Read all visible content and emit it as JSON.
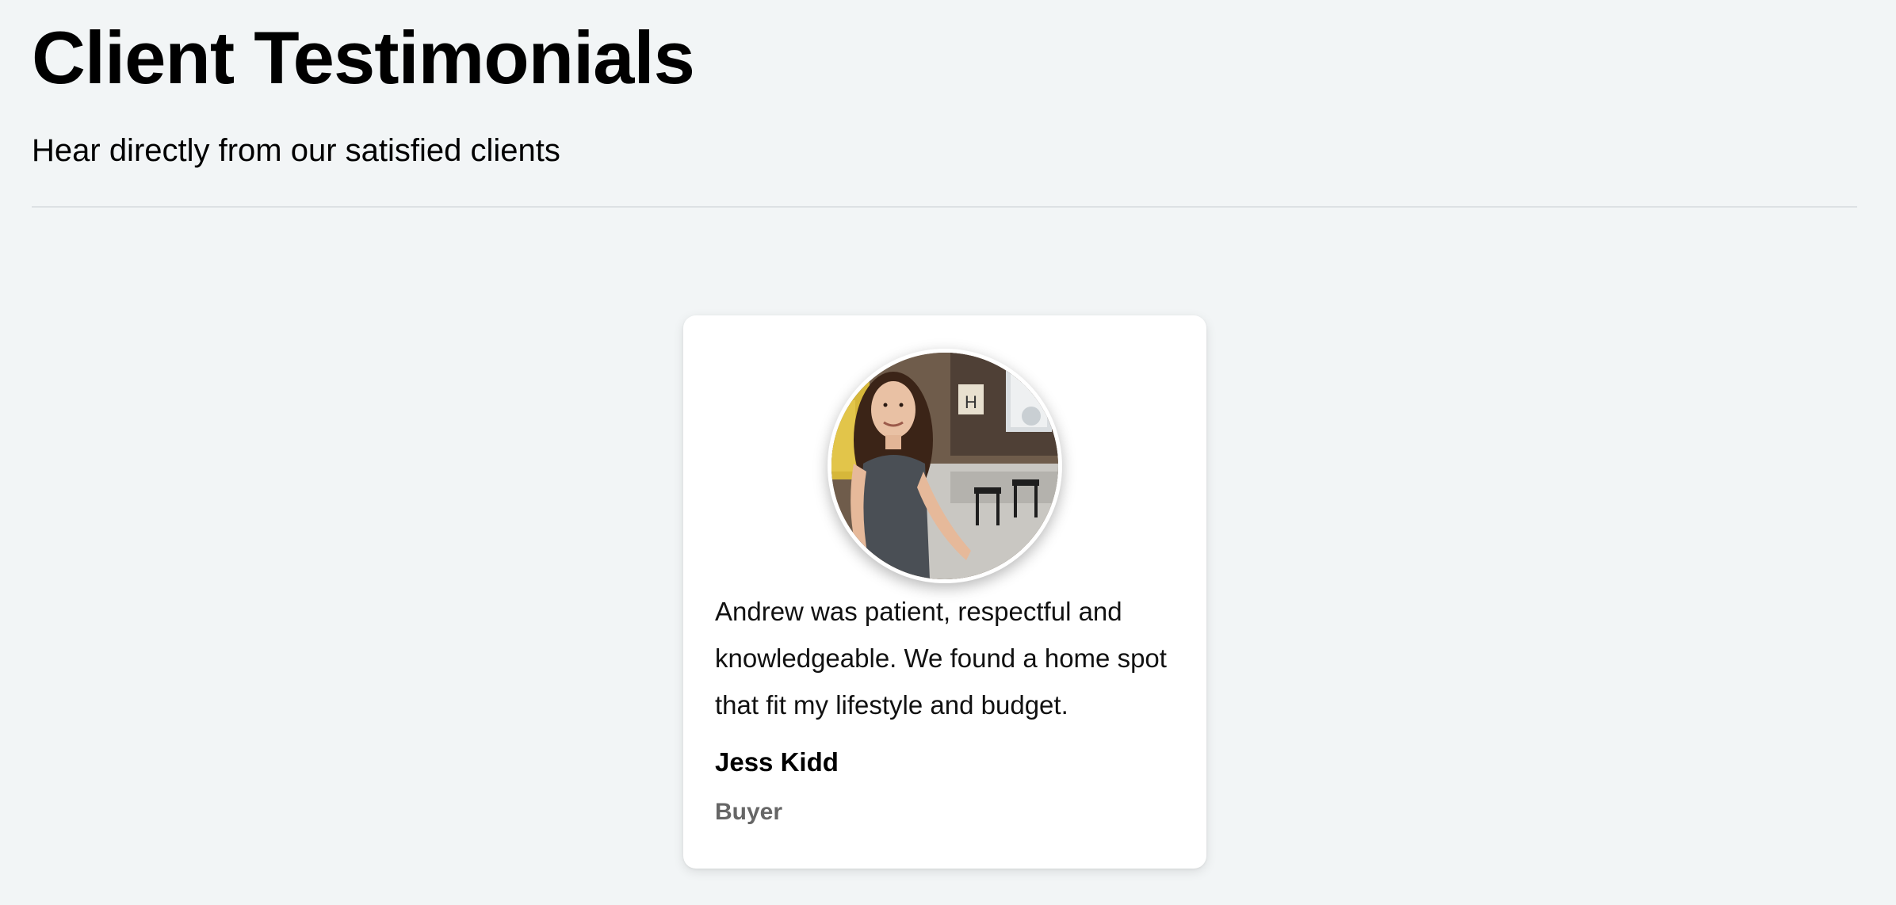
{
  "header": {
    "title": "Client Testimonials",
    "subtitle": "Hear directly from our satisfied clients"
  },
  "testimonials": [
    {
      "avatar_icon": "client-photo",
      "quote": "Andrew was patient, respectful and knowledgeable. We found a home spot that fit my lifestyle and budget.",
      "name": "Jess Kidd",
      "role": "Buyer"
    }
  ],
  "colors": {
    "background": "#f2f5f6",
    "card": "#ffffff",
    "divider": "#dde1e4",
    "role_text": "#666666"
  }
}
